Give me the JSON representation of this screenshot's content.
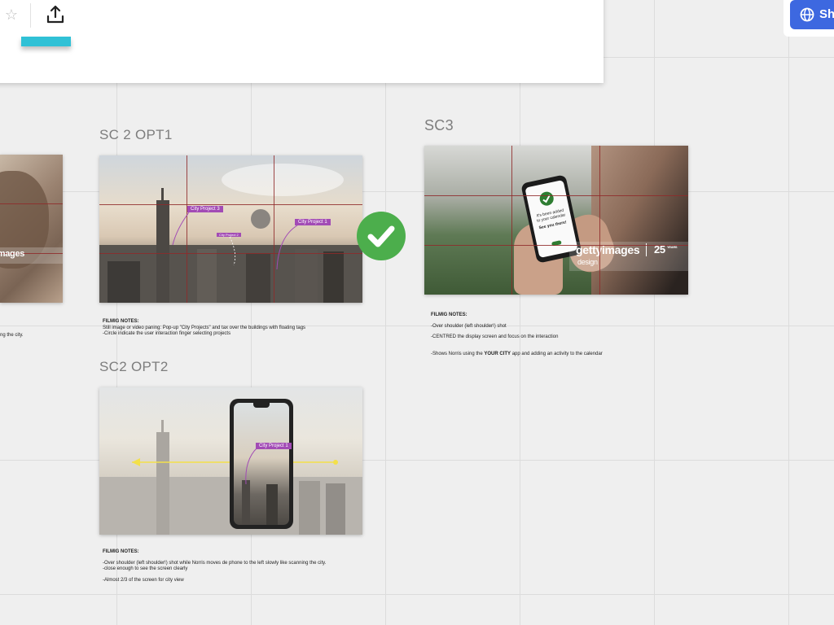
{
  "toolbar": {
    "star_icon": "star-outline-icon",
    "upload_icon": "upload-icon",
    "share_label": "Sh",
    "share_icon": "globe-icon",
    "accent_color": "#3d68e0",
    "tile_color": "#30c1d6"
  },
  "left_partial": {
    "watermark": "images",
    "notes_line": "ng the city."
  },
  "sc2_opt1": {
    "heading": "SC 2 OPT1",
    "tags": [
      "City Project 3",
      "City Project 1",
      "City Project 2"
    ],
    "notes_title": "FILMIG NOTES:",
    "notes": [
      "Still image or video paning: Pop-up \"City Projects\" and tax over the buildings  with floating tags",
      "-Circle indicate the user interaction finger selecting projects"
    ]
  },
  "approved": {
    "icon": "checkmark-circle-icon",
    "color": "#4cae4c"
  },
  "sc3": {
    "heading": "SC3",
    "phone_msg_line1": "It's been added",
    "phone_msg_line2": "to your calendar",
    "phone_msg_line3": "See you there!",
    "watermark_brand": "gettyimages",
    "watermark_sub": "design",
    "watermark_years": "25",
    "watermark_years_label": "YEARS",
    "notes_title": "FILMIG NOTES:",
    "notes": [
      "-Over shoulder (left shoulder!) shot",
      "-CENTRED the display screen and focus on the interaction"
    ],
    "notes_last_prefix": "-Shows Norris using the ",
    "notes_last_bold": "YOUR CITY",
    "notes_last_suffix": " app and adding an activity to the calendar"
  },
  "sc2_opt2": {
    "heading": "SC2 OPT2",
    "tag": "City Project 1",
    "notes_title": "FILMIG NOTES:",
    "notes": [
      "-Over shoulder (left shoulder!) shot while Norris moves de phone to the left slowly like scanning the city.",
      "-close enough to see the screen clearly"
    ],
    "notes_last": "-Almost 2/3 of the screen for city view"
  }
}
